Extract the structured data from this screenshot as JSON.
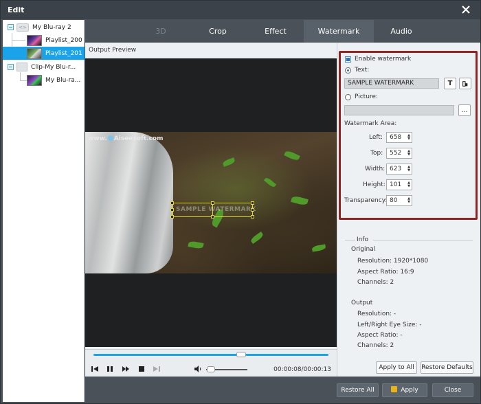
{
  "window": {
    "title": "Edit"
  },
  "tree": {
    "items": [
      {
        "label": "My Blu-ray 2"
      },
      {
        "label": "Playlist_200"
      },
      {
        "label": "Playlist_201"
      },
      {
        "label": "Clip-My Blu-r..."
      },
      {
        "label": "My Blu-ra..."
      }
    ]
  },
  "tabs": [
    {
      "label": "3D",
      "state": "disabled"
    },
    {
      "label": "Crop"
    },
    {
      "label": "Effect"
    },
    {
      "label": "Watermark",
      "state": "active"
    },
    {
      "label": "Audio"
    }
  ],
  "preview": {
    "label": "Output Preview",
    "logo_text_a": "www.",
    "logo_text_b": "Aiseesoft.com",
    "watermark_text": "SAMPLE WATERMARK",
    "playback_fraction": 0.63,
    "volume_fraction": 0.12,
    "timecode": "00:00:08/00:00:13"
  },
  "watermark": {
    "enable_label": "Enable watermark",
    "enabled": true,
    "text_label": "Text:",
    "text_value": "SAMPLE WATERMARK",
    "text_font_button": "T",
    "picture_label": "Picture:",
    "picture_value": "",
    "browse_label": "...",
    "area_label": "Watermark Area:",
    "left_label": "Left:",
    "left_value": "658",
    "top_label": "Top:",
    "top_value": "552",
    "width_label": "Width:",
    "width_value": "623",
    "height_label": "Height:",
    "height_value": "101",
    "transparency_label": "Transparency:",
    "transparency_value": "80"
  },
  "info": {
    "heading": "Info",
    "original_heading": "Original",
    "original": {
      "resolution": "Resolution: 1920*1080",
      "aspect": "Aspect Ratio: 16:9",
      "channels": "Channels: 2"
    },
    "output_heading": "Output",
    "output": {
      "resolution": "Resolution: -",
      "eye_size": "Left/Right Eye Size: -",
      "aspect": "Aspect Ratio: -",
      "channels": "Channels: 2"
    }
  },
  "buttons": {
    "apply_to_all": "Apply to All",
    "restore_defaults": "Restore Defaults",
    "restore_all": "Restore All",
    "apply": "Apply",
    "close": "Close"
  },
  "colors": {
    "accent": "#1aa3e8",
    "highlight_border": "#8e2424",
    "watermark_box": "#e0d234",
    "chrome": "#4a5158"
  }
}
